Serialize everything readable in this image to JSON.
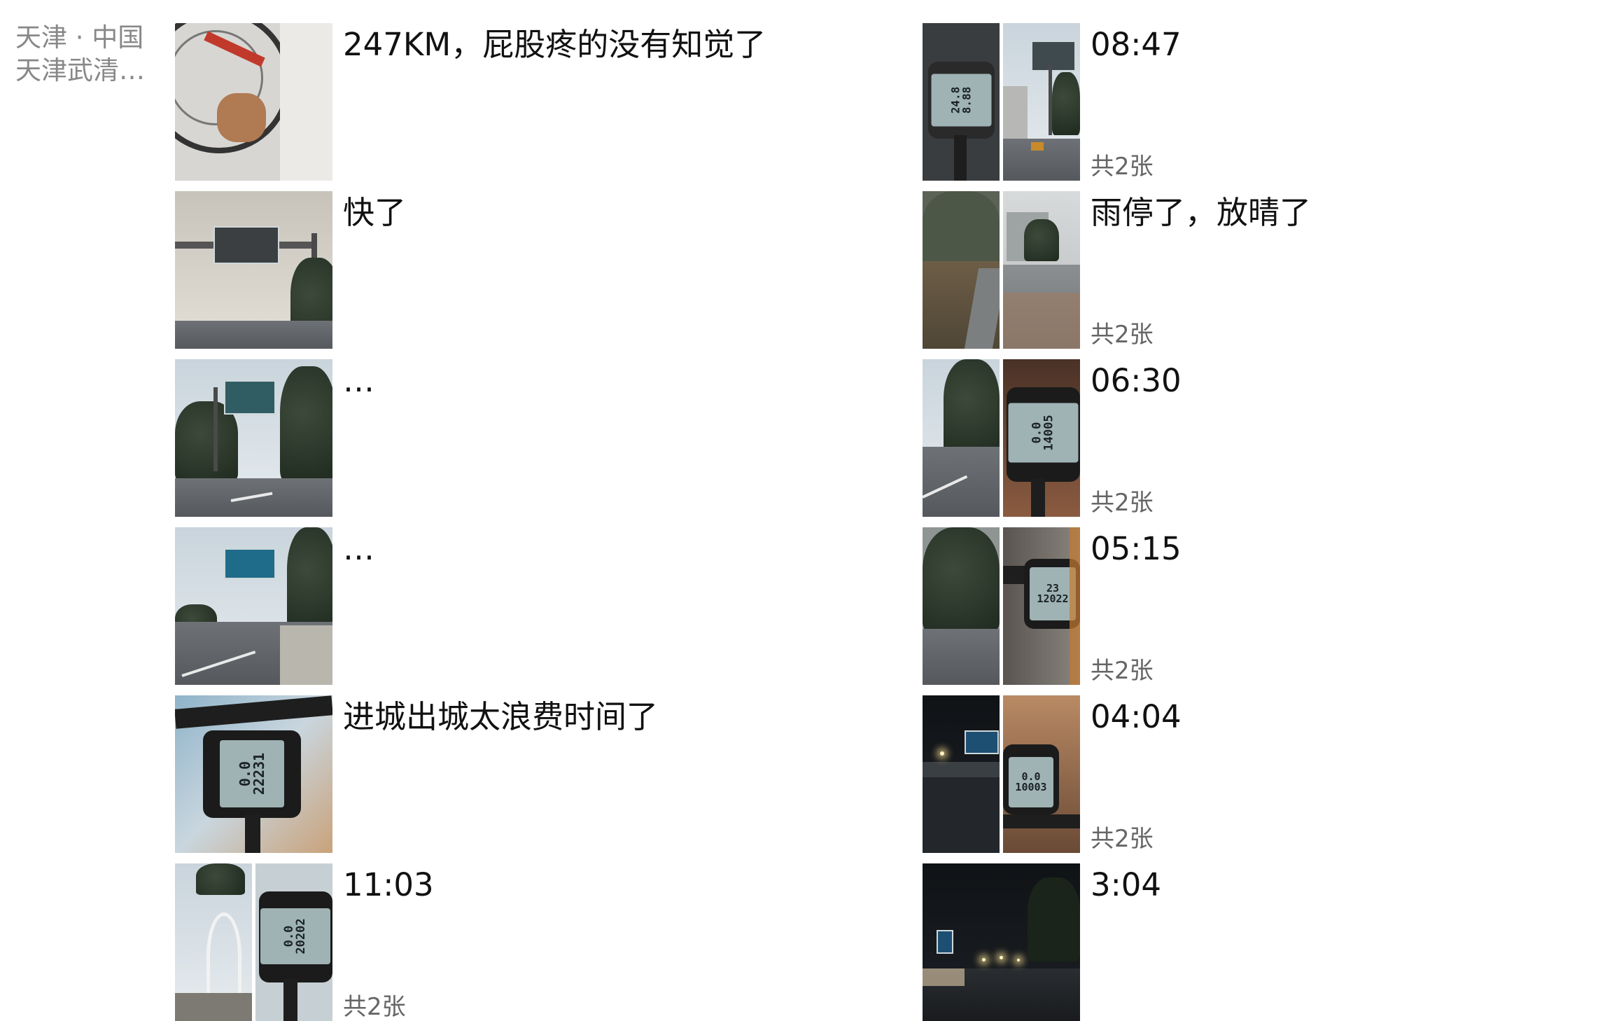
{
  "location": {
    "line1": "天津 · 中国",
    "line2": "天津武清…"
  },
  "posts_left": [
    {
      "caption": "247KM，屁股疼的没有知觉了",
      "count": ""
    },
    {
      "caption": "快了",
      "count": ""
    },
    {
      "caption": "…",
      "count": ""
    },
    {
      "caption": "…",
      "count": ""
    },
    {
      "caption": "进城出城太浪费时间了",
      "count": ""
    },
    {
      "caption": "11:03",
      "count": "共2张"
    }
  ],
  "posts_right": [
    {
      "caption": "08:47",
      "count": "共2张"
    },
    {
      "caption": "雨停了，放晴了",
      "count": "共2张"
    },
    {
      "caption": "06:30",
      "count": "共2张"
    },
    {
      "caption": "05:15",
      "count": "共2张"
    },
    {
      "caption": "04:04",
      "count": "共2张"
    },
    {
      "caption": "3:04",
      "count": ""
    }
  ],
  "lcd_readouts": {
    "left_5": "0.0 22231",
    "left_6": "0.0 20202",
    "right_1": "24.8 8.88",
    "right_3": "0.0 14005",
    "right_4": "23 12022",
    "right_5": "0.0 10003"
  }
}
